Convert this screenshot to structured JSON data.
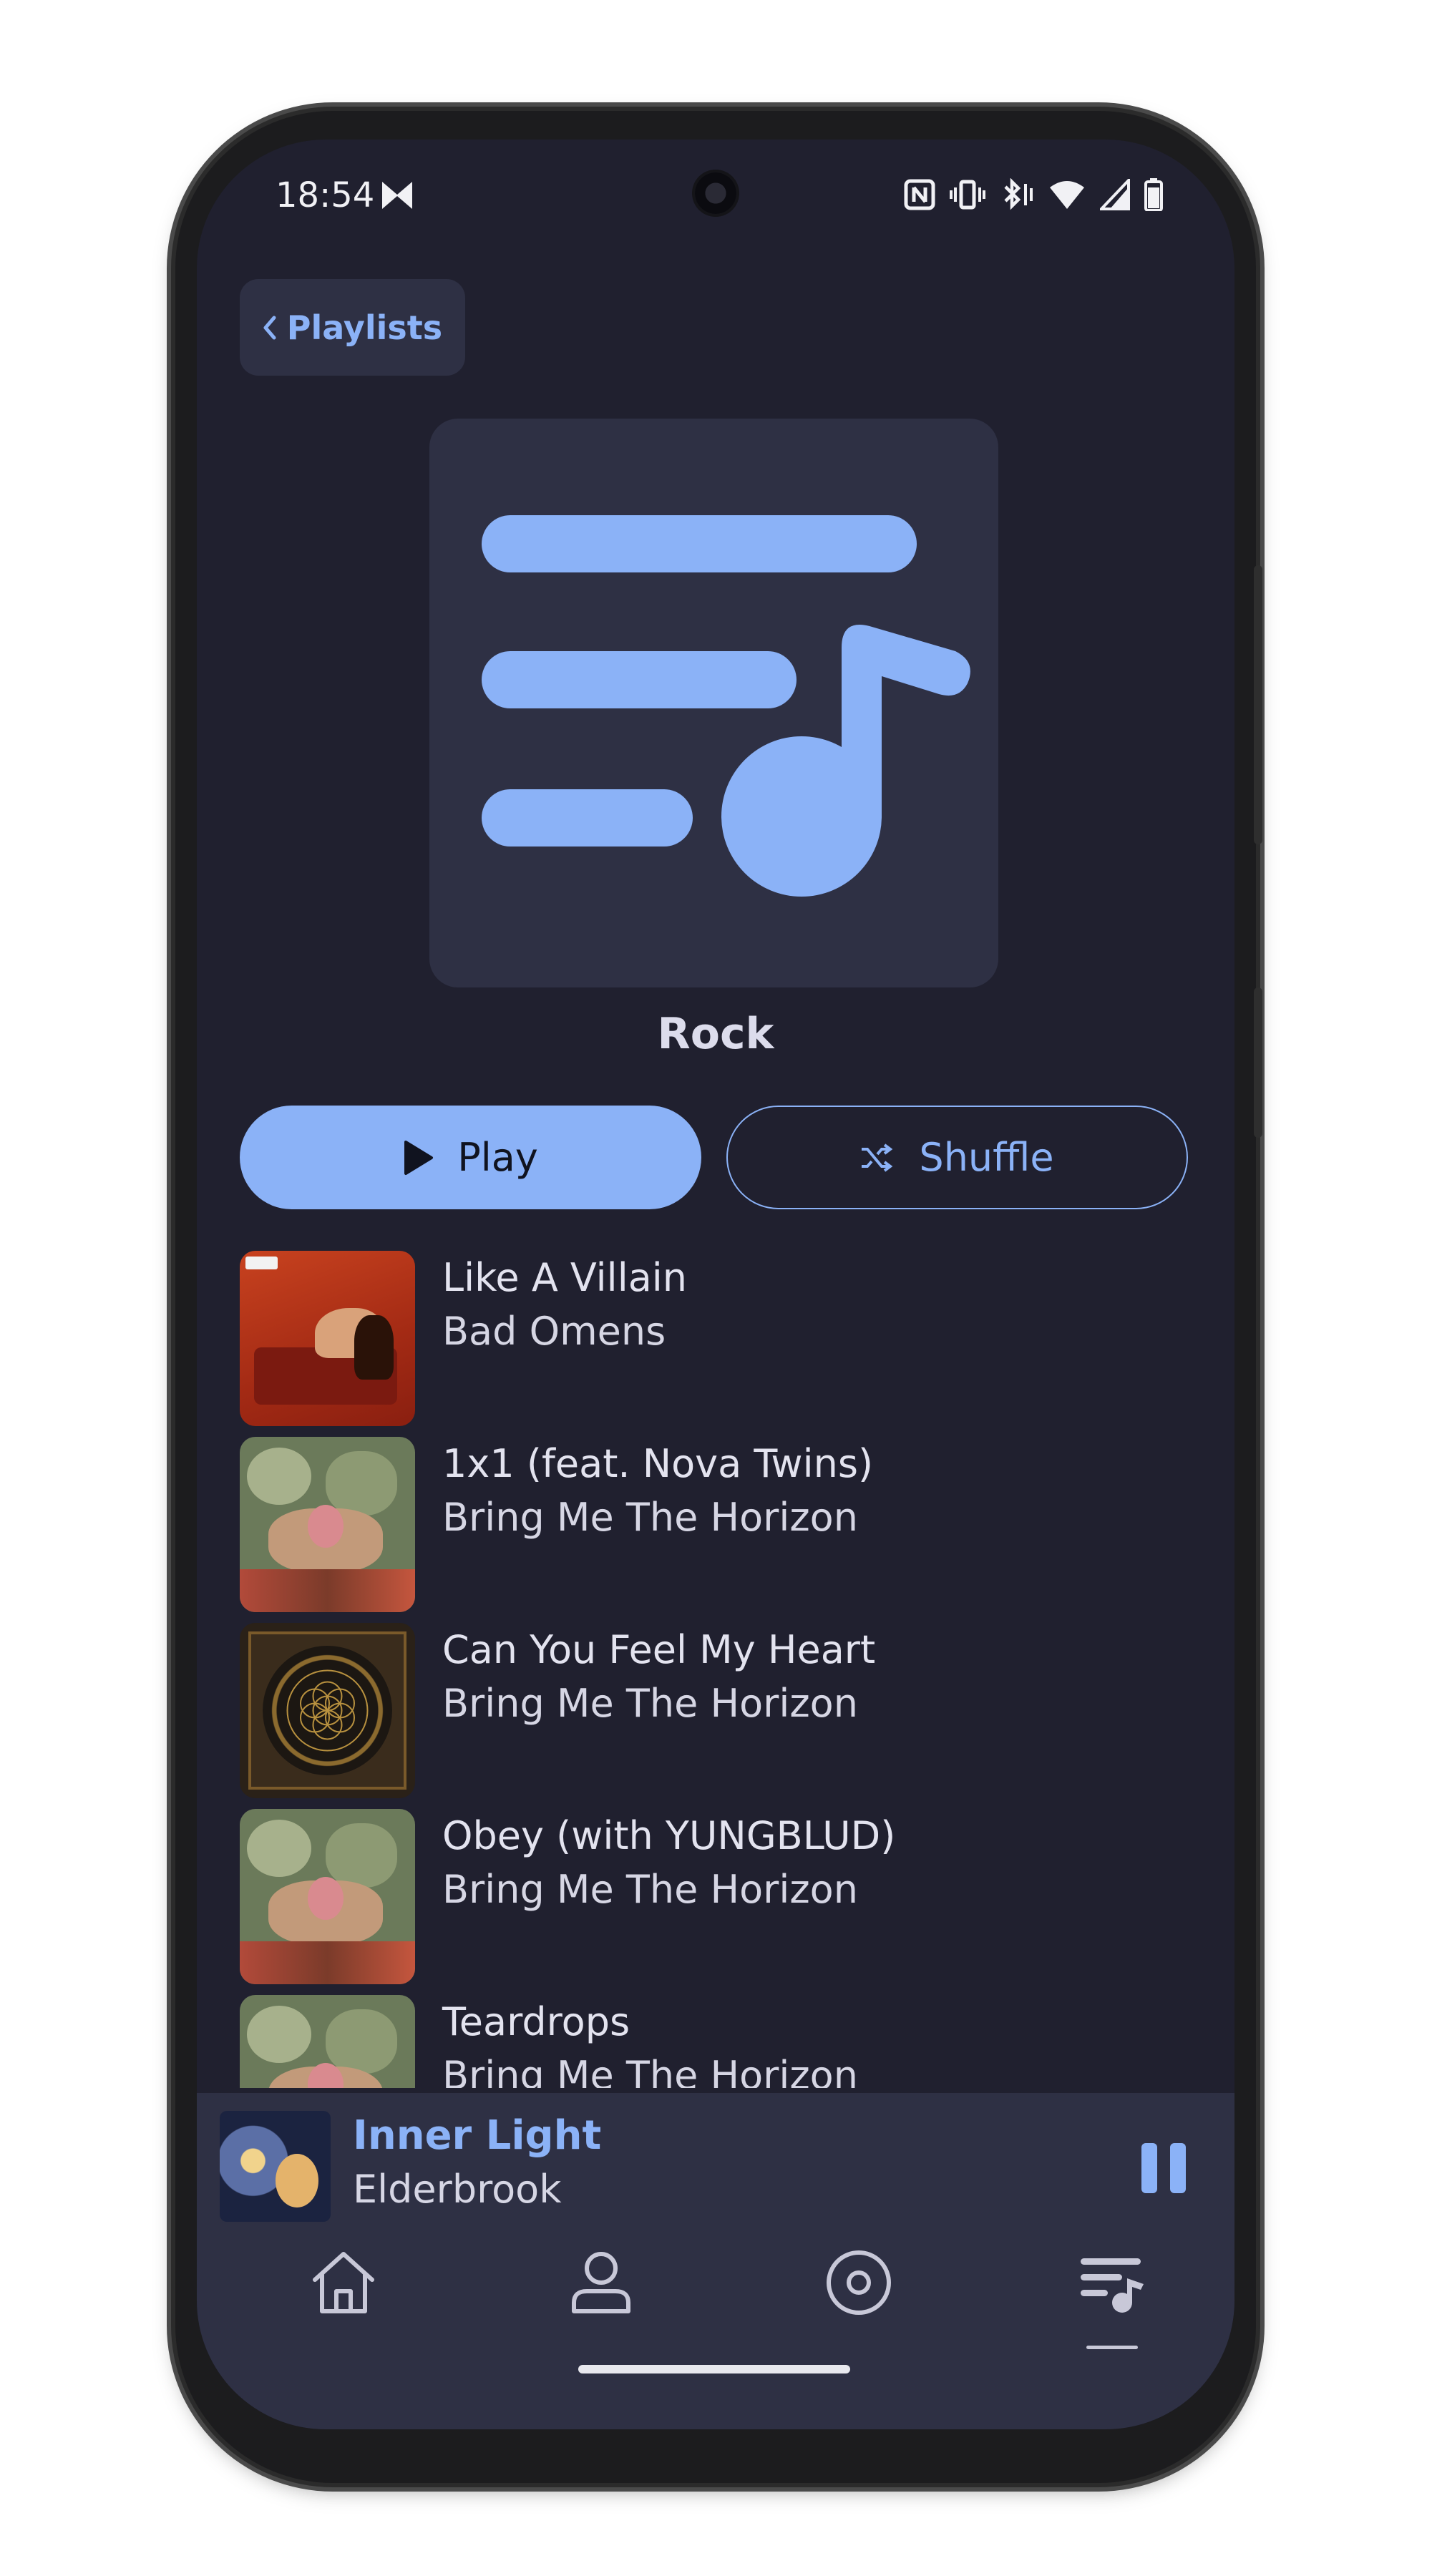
{
  "status_bar": {
    "time": "18:54",
    "icons": [
      "app-notification-icon",
      "nfc-icon",
      "vibrate-icon",
      "bluetooth-icon",
      "wifi-icon",
      "signal-icon",
      "battery-icon"
    ]
  },
  "header": {
    "back_label": "Playlists"
  },
  "playlist": {
    "title": "Rock",
    "cover_icon": "playlist-music-icon"
  },
  "actions": {
    "play_label": "Play",
    "shuffle_label": "Shuffle"
  },
  "tracks": [
    {
      "title": "Like A Villain",
      "artist": "Bad Omens"
    },
    {
      "title": "1x1 (feat. Nova Twins)",
      "artist": "Bring Me The Horizon"
    },
    {
      "title": "Can You Feel My Heart",
      "artist": "Bring Me The Horizon"
    },
    {
      "title": "Obey (with YUNGBLUD)",
      "artist": "Bring Me The Horizon"
    },
    {
      "title": "Teardrops",
      "artist": "Bring Me The Horizon"
    }
  ],
  "now_playing": {
    "title": "Inner Light",
    "artist": "Elderbrook",
    "state": "playing"
  },
  "nav": {
    "items": [
      "home-icon",
      "profile-icon",
      "album-icon",
      "playlists-icon"
    ],
    "active": "playlists-icon"
  },
  "colors": {
    "background": "#20202f",
    "surface": "#2e3044",
    "accent": "#8bb2f7",
    "text": "#e3e3ef"
  }
}
